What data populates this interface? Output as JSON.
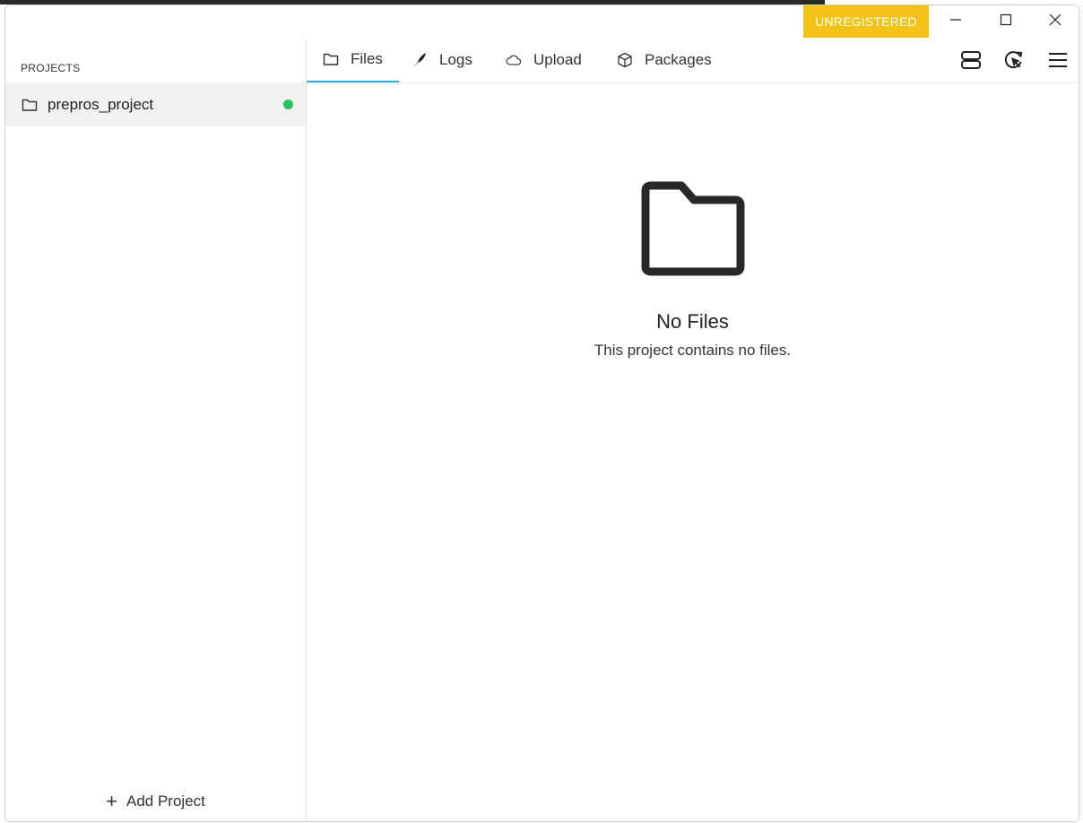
{
  "window": {
    "license_badge": "UNREGISTERED"
  },
  "sidebar": {
    "heading": "PROJECTS",
    "projects": [
      {
        "name": "prepros_project",
        "status_color": "#22c55e"
      }
    ],
    "add_project_label": "Add Project"
  },
  "tabs": [
    {
      "label": "Files",
      "icon": "folder-icon",
      "active": true
    },
    {
      "label": "Logs",
      "icon": "feather-icon",
      "active": false
    },
    {
      "label": "Upload",
      "icon": "cloud-icon",
      "active": false
    },
    {
      "label": "Packages",
      "icon": "package-icon",
      "active": false
    }
  ],
  "toolbar": {
    "icons": [
      "server-icon",
      "live-preview-icon",
      "menu-icon"
    ]
  },
  "main": {
    "empty_title": "No Files",
    "empty_subtitle": "This project contains no files."
  },
  "colors": {
    "badge": "#f2c315",
    "active_tab": "#29a9e0",
    "status_dot": "#22c55e"
  }
}
